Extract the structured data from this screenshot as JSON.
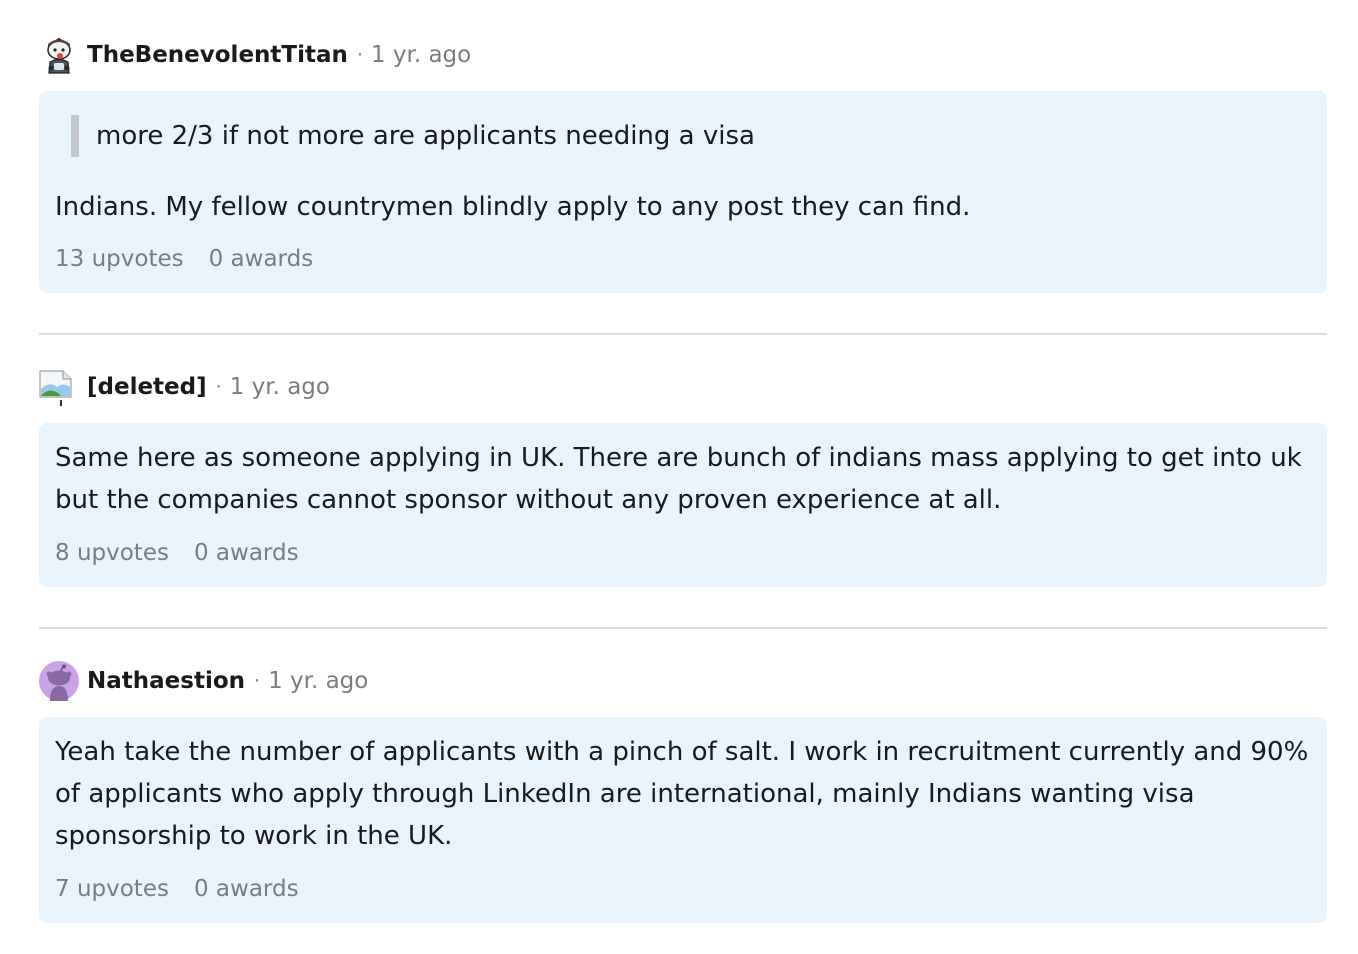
{
  "comments": [
    {
      "username": "TheBenevolentTitan",
      "separator": "·",
      "timestamp": "1 yr. ago",
      "avatar_icon": "snoo-custom-avatar-icon",
      "quote": "more 2/3 if not more are applicants needing a visa",
      "body": "Indians. My fellow countrymen blindly apply to any post they can find.",
      "upvotes": "13 upvotes",
      "awards": "0 awards"
    },
    {
      "username": "[deleted]",
      "separator": "·",
      "timestamp": "1 yr. ago",
      "avatar_icon": "broken-image-icon",
      "body": "Same here as someone applying in UK. There are bunch of indians mass applying to get into uk but the companies cannot sponsor without any proven experience at all.",
      "upvotes": "8 upvotes",
      "awards": "0 awards"
    },
    {
      "username": "Nathaestion",
      "separator": "·",
      "timestamp": "1 yr. ago",
      "avatar_icon": "snoo-default-avatar-icon",
      "body": "Yeah take the number of applicants with a pinch of salt. I work in recruitment currently and 90% of applicants who apply through LinkedIn are international, mainly Indians wanting visa sponsorship to work in the UK.",
      "upvotes": "7 upvotes",
      "awards": "0 awards"
    }
  ],
  "colors": {
    "bubble_bg": "#e9f3fb",
    "meta_text": "#7c7c7c",
    "divider": "#dcdcdc",
    "quote_bar": "#c3c7cb",
    "default_avatar": "#c9a3e6"
  }
}
